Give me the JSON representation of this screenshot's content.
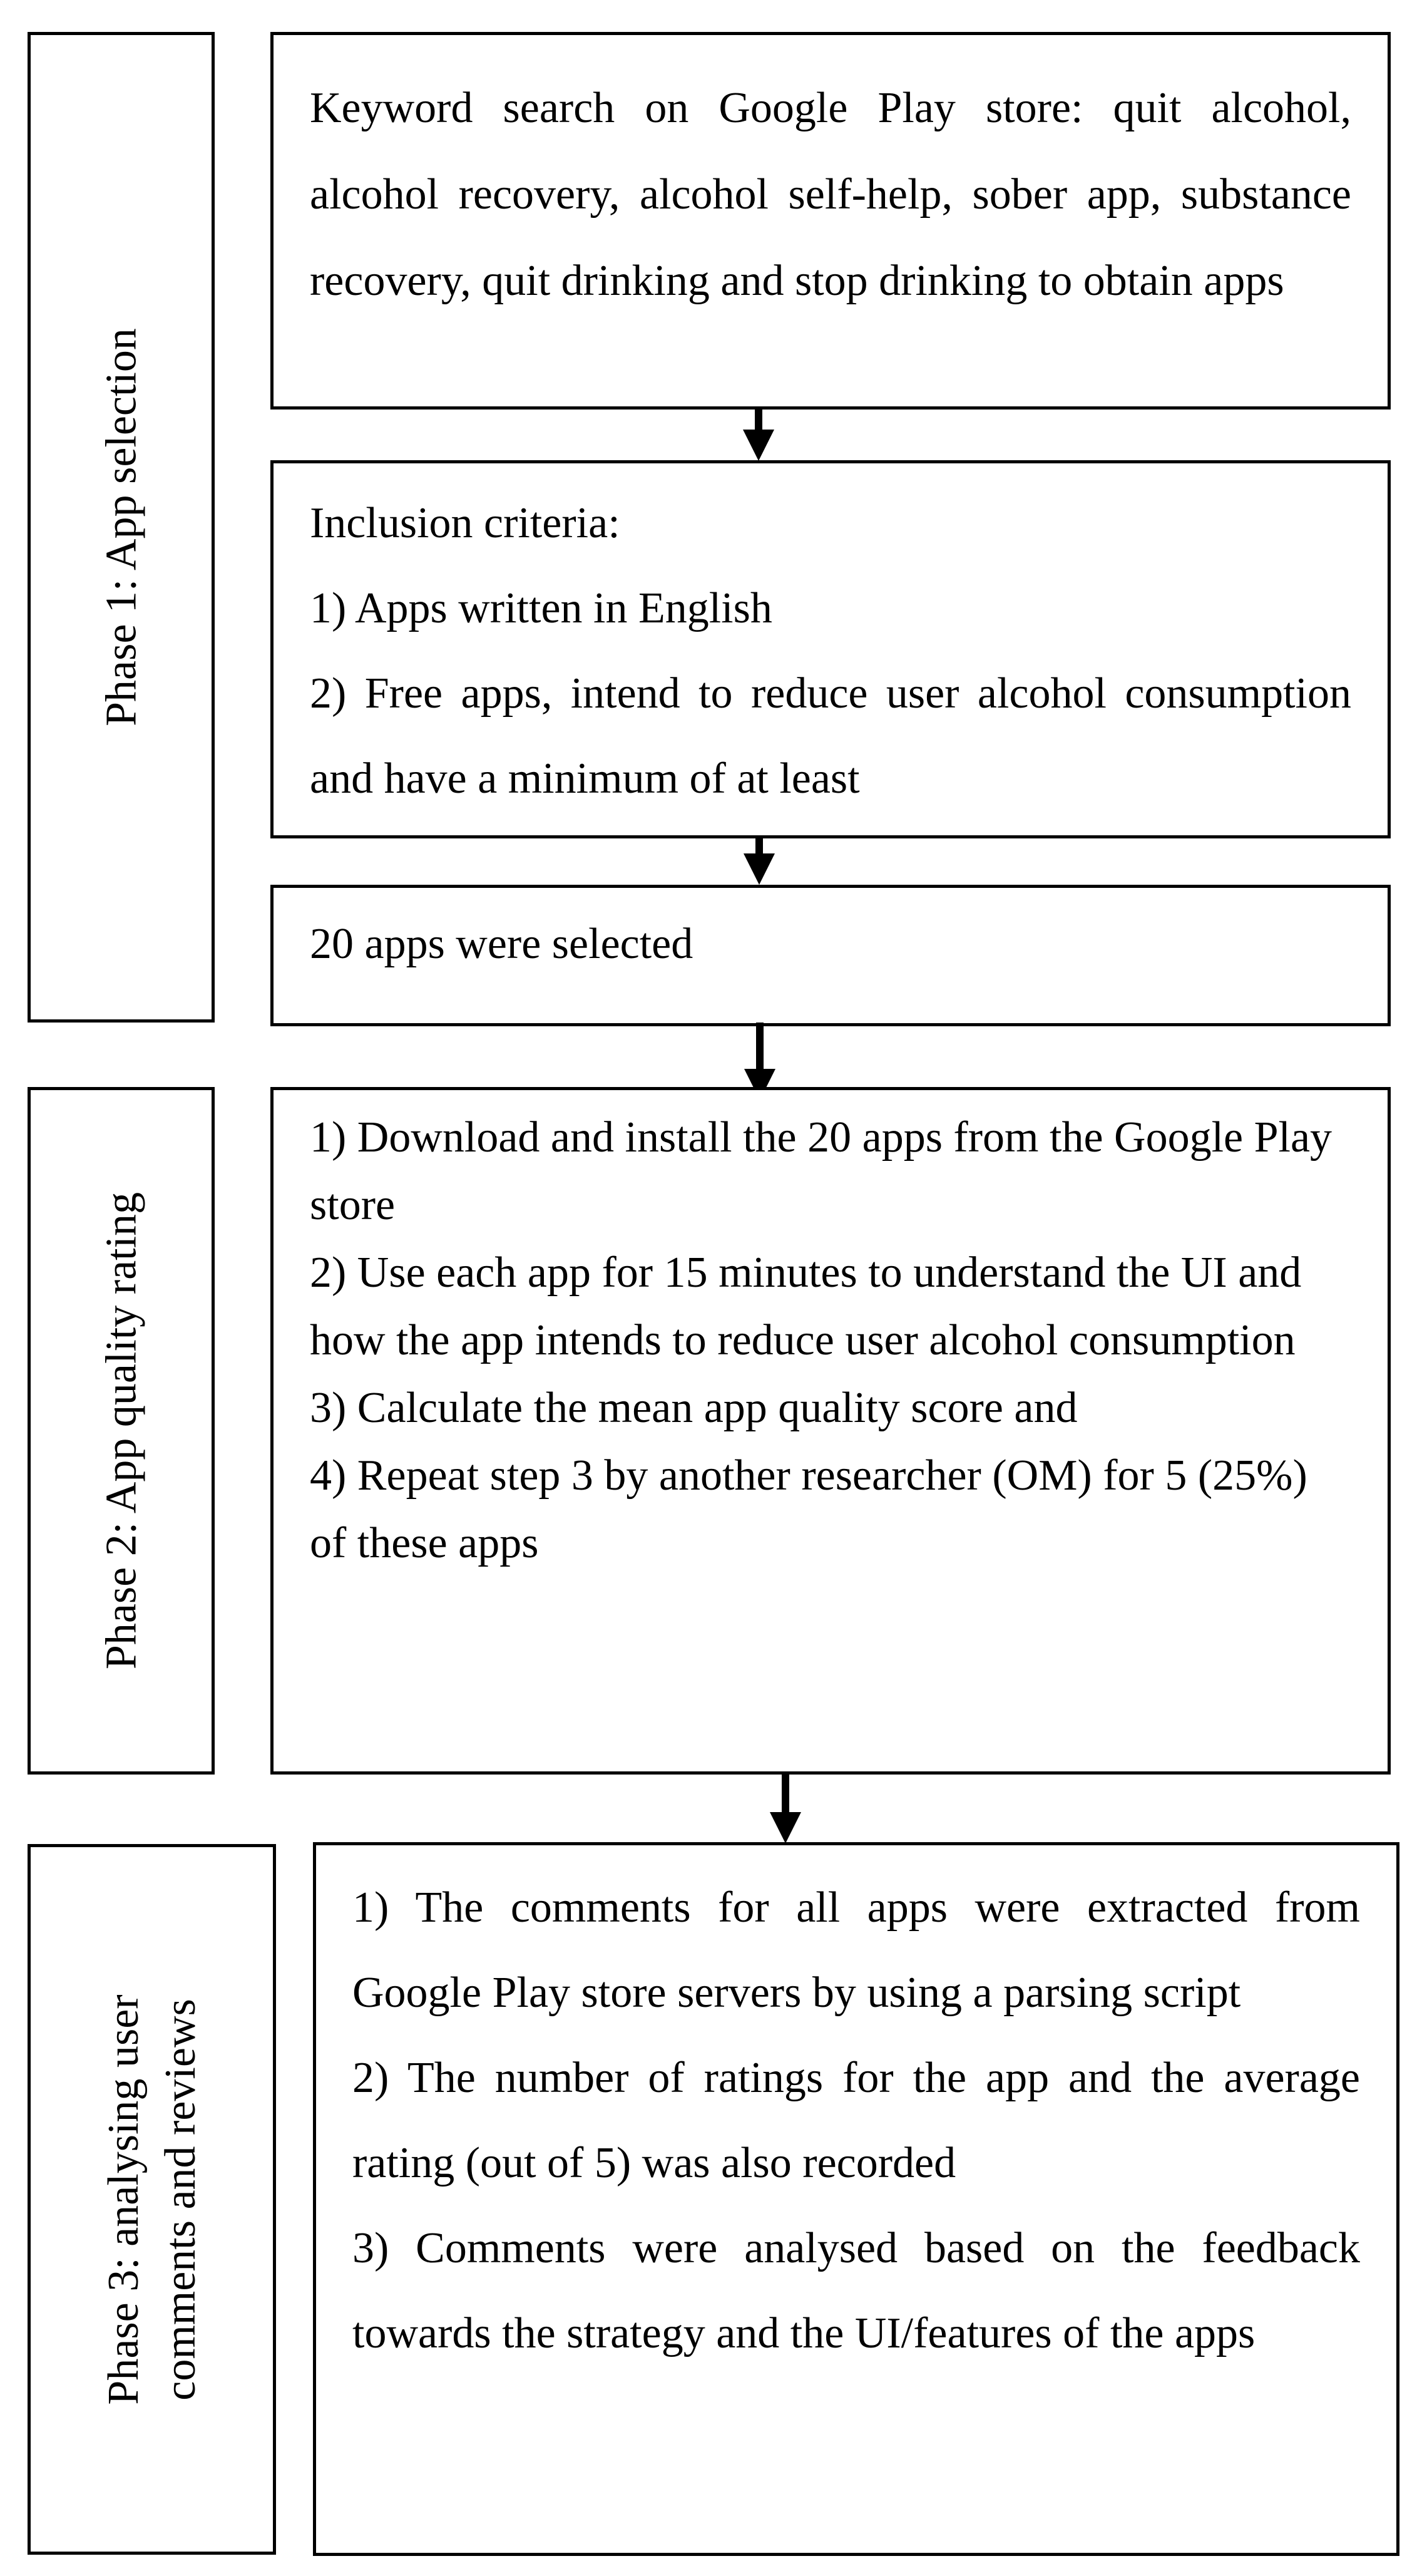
{
  "phases": [
    {
      "label": "Phase 1: App selection",
      "steps": [
        {
          "lines": [
            "Keyword search on Google Play store: quit alcohol, alcohol recovery, alcohol self-help, sober app, substance recovery, quit drinking and stop drinking to obtain apps"
          ]
        },
        {
          "lines": [
            "Inclusion criteria:",
            "1) Apps written in English",
            "2) Free apps, intend to reduce user alcohol consumption and have a minimum of at least"
          ]
        },
        {
          "lines": [
            "20 apps were selected"
          ]
        }
      ]
    },
    {
      "label": "Phase 2: App quality rating",
      "steps": [
        {
          "lines": [
            "1) Download and install the 20 apps from the Google Play store",
            "2) Use each app for 15 minutes to understand the UI and how the app intends to reduce user alcohol consumption",
            "3) Calculate the mean app quality score and",
            "4) Repeat step 3 by another researcher (OM) for 5 (25%) of these apps"
          ]
        }
      ]
    },
    {
      "label_lines": [
        "Phase 3: analysing user",
        "comments and reviews"
      ],
      "steps": [
        {
          "lines": [
            "1) The comments for all apps were extracted from Google Play store servers by using a parsing script",
            "2) The number of ratings for the app and the average rating (out of 5) was also recorded",
            "3) Comments were analysed based on the feedback towards the strategy and the UI/features of the apps"
          ]
        }
      ]
    }
  ]
}
